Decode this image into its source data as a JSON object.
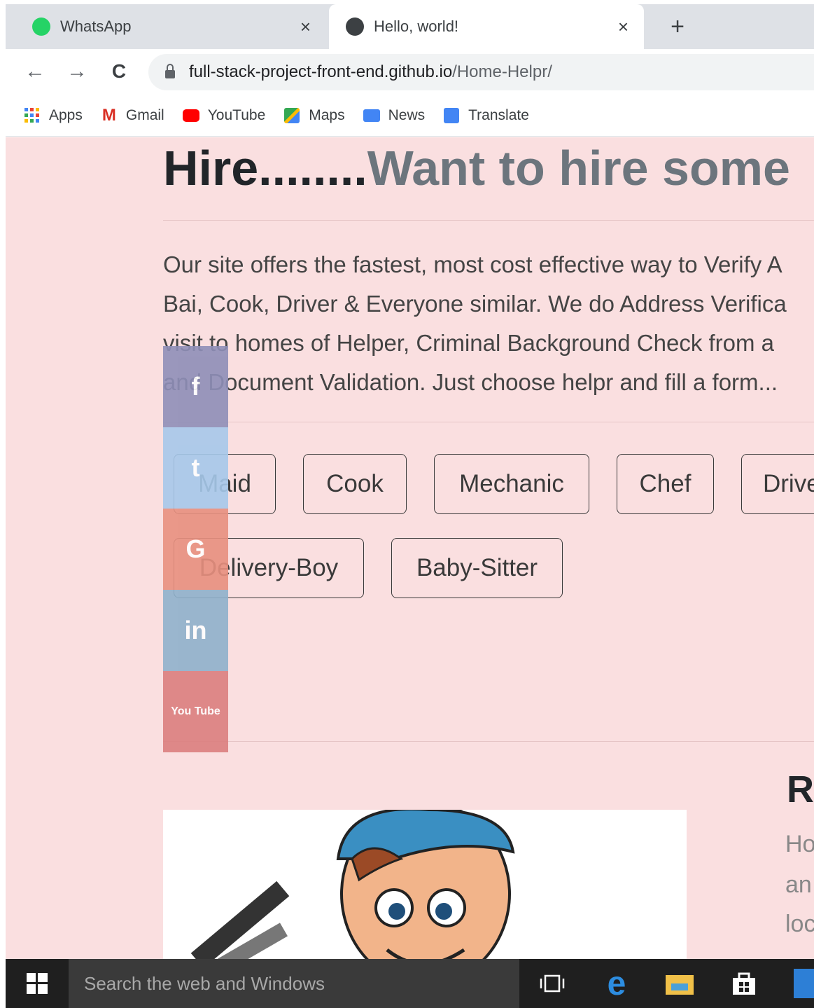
{
  "tabs": [
    {
      "title": "WhatsApp",
      "icon": "whatsapp-icon",
      "close": "×"
    },
    {
      "title": "Hello, world!",
      "icon": "globe-icon",
      "close": "×"
    }
  ],
  "new_tab": "+",
  "toolbar": {
    "back": "←",
    "forward": "→",
    "reload": "C",
    "url_host": "full-stack-project-front-end.github.io",
    "url_path": "/Home-Helpr/"
  },
  "bookmarks": [
    {
      "label": "Apps",
      "icon": "apps-grid-icon"
    },
    {
      "label": "Gmail",
      "icon": "gmail-icon"
    },
    {
      "label": "YouTube",
      "icon": "youtube-icon"
    },
    {
      "label": "Maps",
      "icon": "maps-icon"
    },
    {
      "label": "News",
      "icon": "news-icon"
    },
    {
      "label": "Translate",
      "icon": "translate-icon"
    }
  ],
  "page": {
    "heading_main": "Hire........",
    "heading_sub": "Want to hire some",
    "lead_lines": [
      "Our site offers the fastest, most cost effective way to Verify A",
      "Bai, Cook, Driver & Everyone similar. We do Address Verifica",
      "visit to homes of Helper, Criminal Background Check from a",
      "and Document Validation. Just choose helpr and fill a form..."
    ],
    "job_buttons_row1": [
      "Maid",
      "Cook",
      "Mechanic",
      "Chef",
      "Drive"
    ],
    "job_buttons_row2": [
      "Delivery-Boy",
      "Baby-Sitter"
    ],
    "social": [
      {
        "icon": "facebook-icon",
        "glyph": "f",
        "color": "#8f8fb8"
      },
      {
        "icon": "twitter-icon",
        "glyph": "t",
        "color": "#a6c8ea"
      },
      {
        "icon": "google-icon",
        "glyph": "G",
        "color": "#e8907f"
      },
      {
        "icon": "linkedin-icon",
        "glyph": "in",
        "color": "#8fb1cc"
      },
      {
        "icon": "youtube-icon",
        "glyph": "You Tube",
        "color": "#dc7f7f"
      }
    ],
    "right_title": "R",
    "right_lines": [
      "Ho",
      "an",
      "loc"
    ]
  },
  "taskbar": {
    "search_placeholder": "Search the web and Windows",
    "icons": [
      "task-view-icon",
      "edge-icon",
      "file-explorer-icon",
      "store-icon",
      "mail-icon"
    ]
  }
}
